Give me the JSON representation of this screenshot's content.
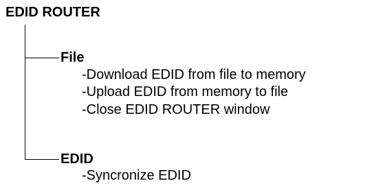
{
  "root": {
    "title": "EDID ROUTER"
  },
  "branches": [
    {
      "label": "File",
      "items": [
        "-Download EDID from file to memory",
        "-Upload EDID from memory to file",
        "-Close EDID ROUTER window"
      ]
    },
    {
      "label": "EDID",
      "items": [
        "-Syncronize EDID"
      ]
    }
  ]
}
